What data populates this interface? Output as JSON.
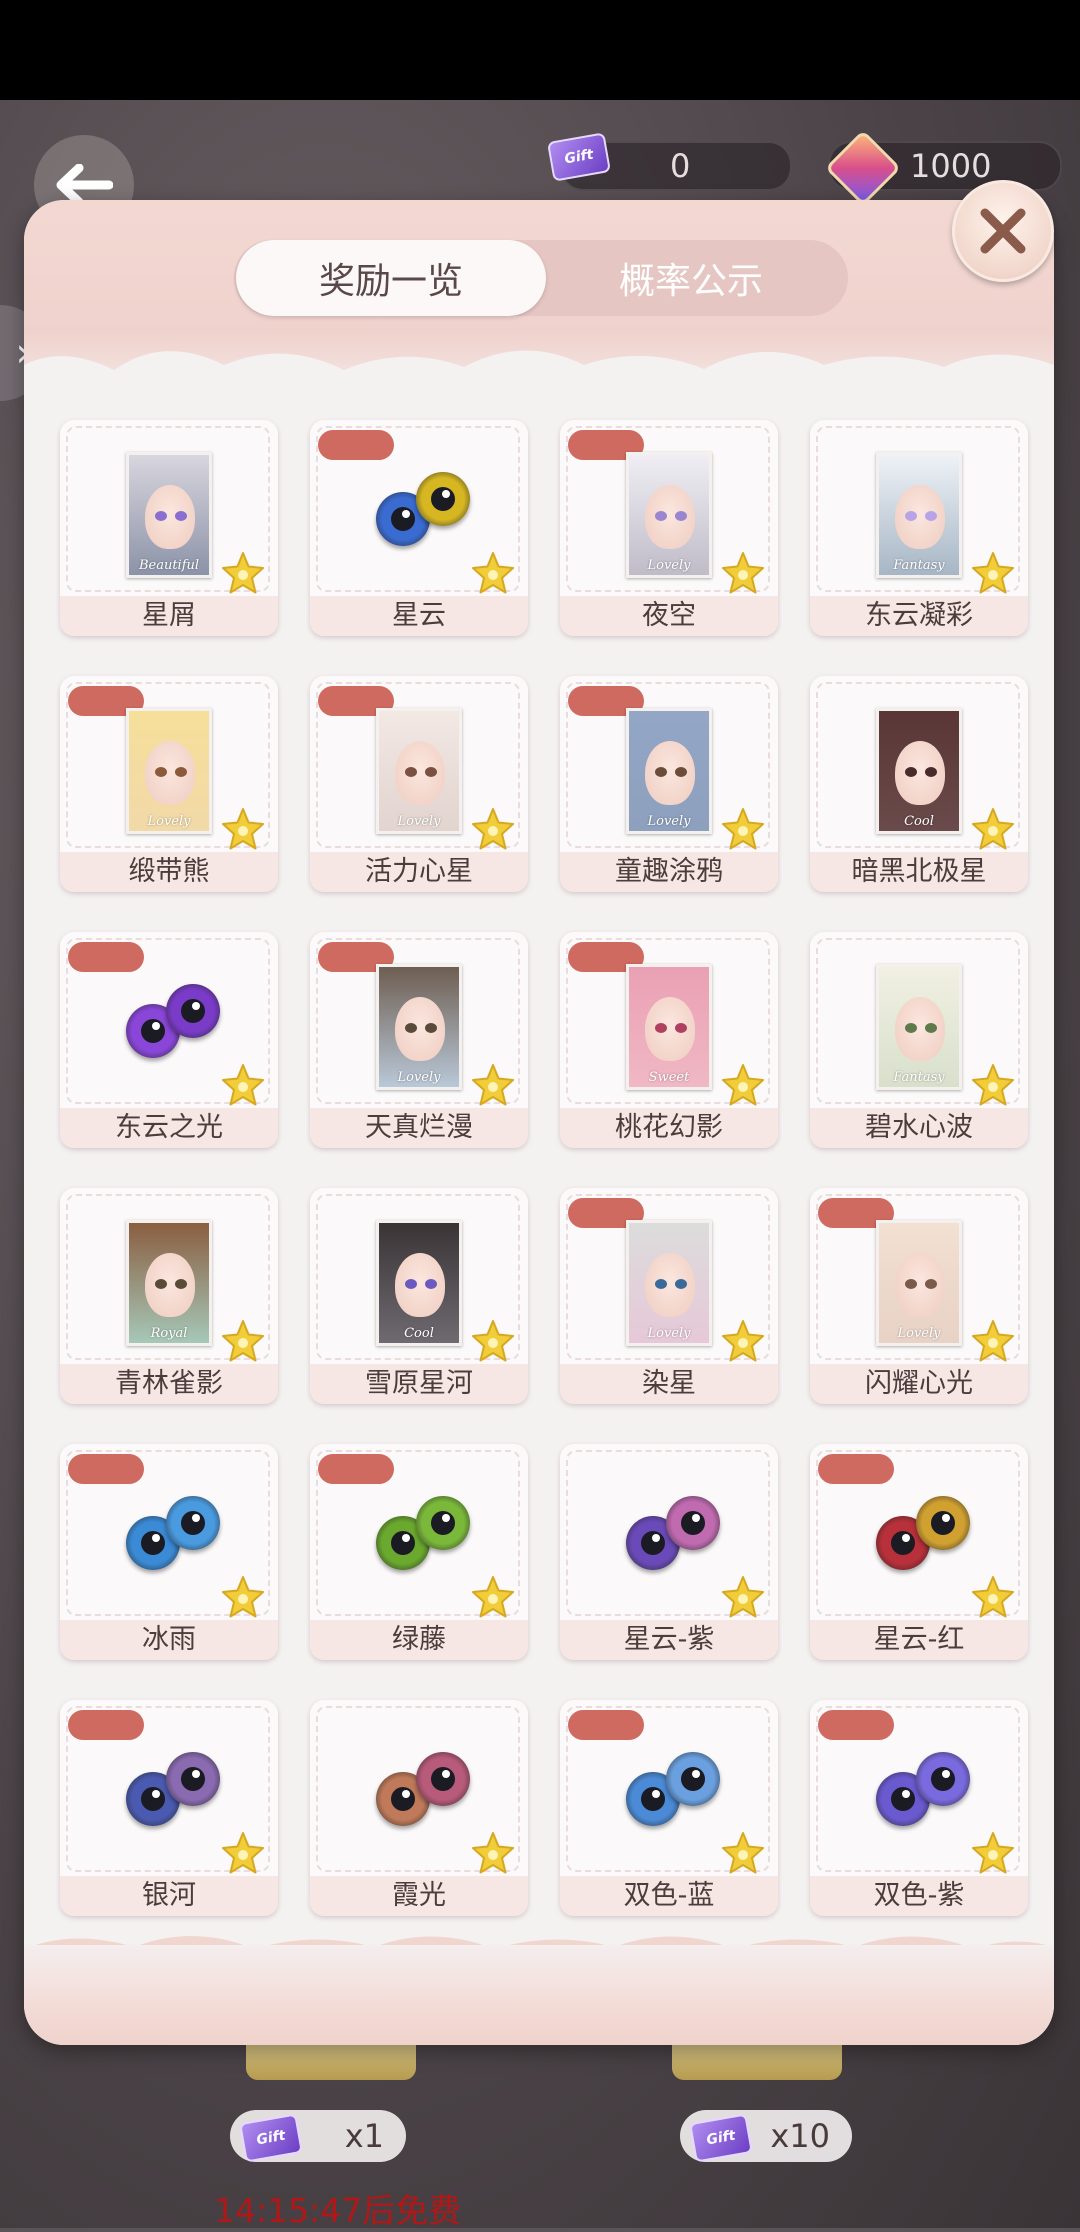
{
  "currencies": {
    "tickets": {
      "value": "0",
      "icon": "ticket-icon",
      "icon_text": "Gift"
    },
    "gems": {
      "value": "1000",
      "icon": "gem-icon"
    }
  },
  "modal": {
    "tabs": [
      {
        "label": "奖励一览",
        "active": true
      },
      {
        "label": "概率公示",
        "active": false
      }
    ],
    "items": [
      {
        "name": "星屑",
        "kind": "card",
        "caption": "Beautiful",
        "bg": "#8c93a8",
        "hair": "#d8d6de",
        "eye": "#8a6fd0",
        "tag": false
      },
      {
        "name": "星云",
        "kind": "eyes",
        "color1": "#3a6bd1",
        "color2": "#d6b722",
        "tag": true
      },
      {
        "name": "夜空",
        "kind": "card",
        "caption": "Lovely",
        "bg": "#bfbcc8",
        "hair": "#f0eef4",
        "eye": "#9a86d0",
        "tag": true
      },
      {
        "name": "东云凝彩",
        "kind": "card",
        "caption": "Fantasy",
        "bg": "#a7b6c6",
        "hair": "#eef2f6",
        "eye": "#b7a3e6",
        "tag": false
      },
      {
        "name": "缎带熊",
        "kind": "card",
        "caption": "Lovely",
        "bg": "#f2d9a8",
        "hair": "#f6df9a",
        "eye": "#8b5a3a",
        "tag": true
      },
      {
        "name": "活力心星",
        "kind": "card",
        "caption": "Lovely",
        "bg": "#e2d4cf",
        "hair": "#f2e8e4",
        "eye": "#7a5040",
        "tag": true
      },
      {
        "name": "童趣涂鸦",
        "kind": "card",
        "caption": "Lovely",
        "bg": "#8da0bd",
        "hair": "#93a6c6",
        "eye": "#6a4e3a",
        "tag": true
      },
      {
        "name": "暗黑北极星",
        "kind": "card",
        "caption": "Cool",
        "bg": "#6a4a4a",
        "hair": "#5a3636",
        "eye": "#4a2b2b",
        "tag": false
      },
      {
        "name": "东云之光",
        "kind": "eyes",
        "color1": "#8a46d8",
        "color2": "#7a3bc8",
        "tag": true
      },
      {
        "name": "天真烂漫",
        "kind": "card",
        "caption": "Lovely",
        "bg": "#b9c8d8",
        "hair": "#6e5e52",
        "eye": "#5a4a3a",
        "tag": true
      },
      {
        "name": "桃花幻影",
        "kind": "card",
        "caption": "Sweet",
        "bg": "#f0b8c4",
        "hair": "#eaa0b4",
        "eye": "#b04060",
        "tag": true
      },
      {
        "name": "碧水心波",
        "kind": "card",
        "caption": "Fantasy",
        "bg": "#d8e0cc",
        "hair": "#f1f0e2",
        "eye": "#5e7a4a",
        "tag": false
      },
      {
        "name": "青林雀影",
        "kind": "card",
        "caption": "Royal",
        "bg": "#a6c8b8",
        "hair": "#8a5e40",
        "eye": "#5a4a38",
        "tag": false
      },
      {
        "name": "雪原星河",
        "kind": "card",
        "caption": "Cool",
        "bg": "#6e6a70",
        "hair": "#3a3436",
        "eye": "#6a5ac0",
        "tag": false
      },
      {
        "name": "染星",
        "kind": "card",
        "caption": "Lovely",
        "bg": "#e6c8d8",
        "hair": "#dcdcdc",
        "eye": "#3a6a9a",
        "tag": true
      },
      {
        "name": "闪耀心光",
        "kind": "card",
        "caption": "Lovely",
        "bg": "#e8d2c6",
        "hair": "#f2e0d2",
        "eye": "#7a5a4a",
        "tag": true
      },
      {
        "name": "冰雨",
        "kind": "eyes",
        "color1": "#3a8ad6",
        "color2": "#4a9ae0",
        "tag": true
      },
      {
        "name": "绿藤",
        "kind": "eyes",
        "color1": "#6aa82e",
        "color2": "#7ab83a",
        "tag": true
      },
      {
        "name": "星云-紫",
        "kind": "eyes",
        "color1": "#6a4ab8",
        "color2": "#c06ab0",
        "tag": false
      },
      {
        "name": "星云-红",
        "kind": "eyes",
        "color1": "#b8303a",
        "color2": "#d0a030",
        "tag": true
      },
      {
        "name": "银河",
        "kind": "eyes",
        "color1": "#4a5ab0",
        "color2": "#8a6ab0",
        "tag": true
      },
      {
        "name": "霞光",
        "kind": "eyes",
        "color1": "#c07a5a",
        "color2": "#b85a7a",
        "tag": false
      },
      {
        "name": "双色-蓝",
        "kind": "eyes",
        "color1": "#4a8ad6",
        "color2": "#6aa0e0",
        "tag": true
      },
      {
        "name": "双色-紫",
        "kind": "eyes",
        "color1": "#6a5ad0",
        "color2": "#7a6ae0",
        "tag": true
      }
    ]
  },
  "bottom": {
    "single": {
      "count": "x1",
      "ticket_text": "Gift"
    },
    "ten": {
      "count": "x10",
      "ticket_text": "Gift"
    },
    "timer": "14:15:47后免费"
  },
  "colors": {
    "accent_tag": "#cf6a60",
    "tab_track": "#e5c6c2"
  }
}
